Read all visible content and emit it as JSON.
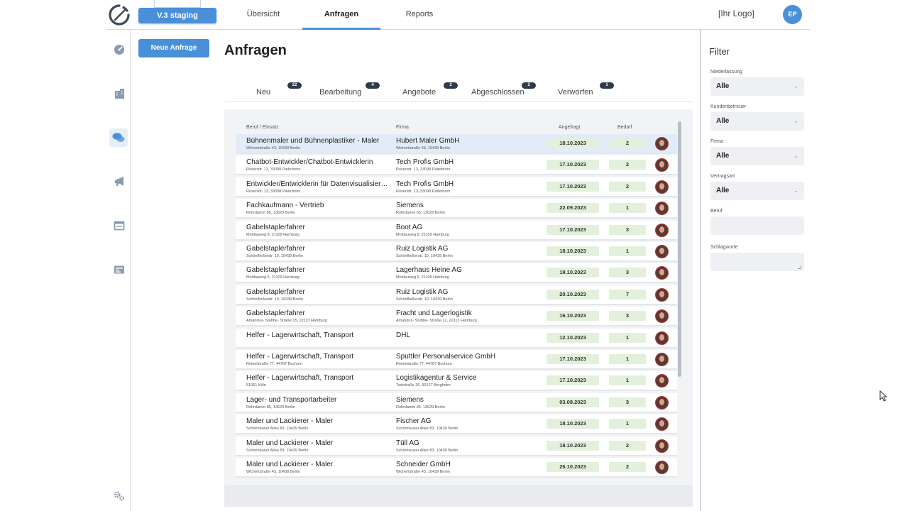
{
  "header": {
    "env_badge": "V.3 staging",
    "nav_tabs": [
      "Übersicht",
      "Anfragen",
      "Reports"
    ],
    "active_tab": "Anfragen",
    "logo_placeholder": "[Ihr Logo]",
    "user_initials": "EP"
  },
  "sidebar": {
    "icons": [
      "dashboard-icon",
      "buildings-icon",
      "chat-icon",
      "megaphone-icon",
      "window-icon",
      "id-card-icon",
      "settings-icon"
    ],
    "active": "chat-icon"
  },
  "main": {
    "new_request_label": "Neue Anfrage",
    "title": "Anfragen",
    "status_tabs": [
      {
        "label": "Neu",
        "count": "22"
      },
      {
        "label": "Bearbeitung",
        "count": "4"
      },
      {
        "label": "Angebote",
        "count": "2"
      },
      {
        "label": "Abgeschlossen",
        "count": "2"
      },
      {
        "label": "Verworfen",
        "count": "1"
      }
    ],
    "columns": {
      "job": "Beruf / Einsatz",
      "company": "Firma",
      "requested": "Angefragt",
      "need": "Bedarf"
    },
    "rows": [
      {
        "job": "Bühnenmaler und Bühnenplastiker - Maler",
        "job_addr": "Wichertstraße 43, 10439 Berlin",
        "company": "Hubert Maler GmbH",
        "company_addr": "Wichertstraße 43, 10439 Berlin",
        "date": "18.10.2023",
        "need": "2"
      },
      {
        "job": "Chatbot-Entwickler/Chatbot-Entwicklerin",
        "job_addr": "Rosenstr. 13, 33098 Paderborn",
        "company": "Tech Profis GmbH",
        "company_addr": "Rosenstr. 13, 33098 Paderborn",
        "date": "17.10.2023",
        "need": "2"
      },
      {
        "job": "Entwickler/Entwicklerin für Datenvisualisierung",
        "job_addr": "Rosenstr. 13, 33098 Paderborn",
        "company": "Tech Profis GmbH",
        "company_addr": "Rosenstr. 13, 33098 Paderborn",
        "date": "17.10.2023",
        "need": "2"
      },
      {
        "job": "Fachkaufmann - Vertrieb",
        "job_addr": "Rohrdamm 85, 13629 Berlin",
        "company": "Siemens",
        "company_addr": "Rohrdamm 85, 13629 Berlin",
        "date": "22.09.2023",
        "need": "1"
      },
      {
        "job": "Gabelstaplerfahrer",
        "job_addr": "Moldauweg 8, 21109 Hamburg",
        "company": "Boot AG",
        "company_addr": "Moldauweg 8, 21109 Hamburg",
        "date": "17.10.2023",
        "need": "3"
      },
      {
        "job": "Gabelstaplerfahrer",
        "job_addr": "Schönfließerstr. 19, 10439 Berlin",
        "company": "Ruiz Logistik AG",
        "company_addr": "Schönfließerstr. 19, 10439 Berlin",
        "date": "18.10.2023",
        "need": "1"
      },
      {
        "job": "Gabelstaplerfahrer",
        "job_addr": "Moldauweg 5, 21109 Hamburg",
        "company": "Lagerhaus Heine AG",
        "company_addr": "Moldauweg 5, 21109 Hamburg",
        "date": "19.10.2023",
        "need": "3"
      },
      {
        "job": "Gabelstaplerfahrer",
        "job_addr": "Schönfließerstr. 19, 10439 Berlin",
        "company": "Ruiz Logistik AG",
        "company_addr": "Schönfließerstr. 19, 10439 Berlin",
        "date": "20.10.2023",
        "need": "7"
      },
      {
        "job": "Gabelstaplerfahrer",
        "job_addr": "Amandus- Stubbe- Straße 15, 22113 Hamburg",
        "company": "Fracht und Lagerlogistik",
        "company_addr": "Amandus- Stubbe- Straße 12, 22113 Hamburg",
        "date": "16.10.2023",
        "need": "3"
      },
      {
        "job": "Helfer - Lagerwirtschaft, Transport",
        "job_addr": "",
        "company": "DHL",
        "company_addr": "",
        "date": "12.10.2023",
        "need": "1"
      },
      {
        "job": "Helfer - Lagerwirtschaft, Transport",
        "job_addr": "Reinelstraße 77, 44787 Bochum",
        "company": "Sputtler Personalservice GmbH",
        "company_addr": "Reinelstraße 77, 44787 Bochum",
        "date": "17.10.2023",
        "need": "1"
      },
      {
        "job": "Helfer - Lagerwirtschaft, Transport",
        "job_addr": "51061 Köln",
        "company": "Logistikagentur & Service",
        "company_addr": "Teststraße 26, 50127 Bergheim",
        "date": "17.10.2023",
        "need": "1"
      },
      {
        "job": "Lager- und Transportarbeiter",
        "job_addr": "Rohrdamm 85, 13629 Berlin",
        "company": "Siemens",
        "company_addr": "Rohrdamm 85, 13629 Berlin",
        "date": "03.08.2023",
        "need": "3"
      },
      {
        "job": "Maler und Lackierer - Maler",
        "job_addr": "Schönhauser Allee 83, 10439 Berlin",
        "company": "Fischer AG",
        "company_addr": "Schönhauser Allee 83, 10439 Berlin",
        "date": "18.10.2023",
        "need": "1"
      },
      {
        "job": "Maler und Lackierer - Maler",
        "job_addr": "Schönhauser Allee 83, 10439 Berlin",
        "company": "Tüll AG",
        "company_addr": "Schönhauser Allee 83, 10439 Berlin",
        "date": "18.10.2023",
        "need": "2"
      },
      {
        "job": "Maler und Lackierer - Maler",
        "job_addr": "Wichertstraße 43, 10438 Berlin",
        "company": "Schneider GmbH",
        "company_addr": "Wichertstraße 43, 10439 Berlin",
        "date": "26.10.2023",
        "need": "2"
      }
    ]
  },
  "filter": {
    "title": "Filter",
    "fields": [
      {
        "label": "Niederlassung",
        "value": "Alle"
      },
      {
        "label": "Kundenbetreuer",
        "value": "Alle"
      },
      {
        "label": "Firma",
        "value": "Alle"
      },
      {
        "label": "Vertragsart",
        "value": "Alle"
      }
    ],
    "beruf_label": "Beruf",
    "keywords_label": "Schlagworte"
  },
  "colors": {
    "accent": "#4a90d9",
    "badge_dark": "#2f3a4b",
    "pill_green": "#e3f0dc",
    "selected_row": "#e2ecf8"
  }
}
